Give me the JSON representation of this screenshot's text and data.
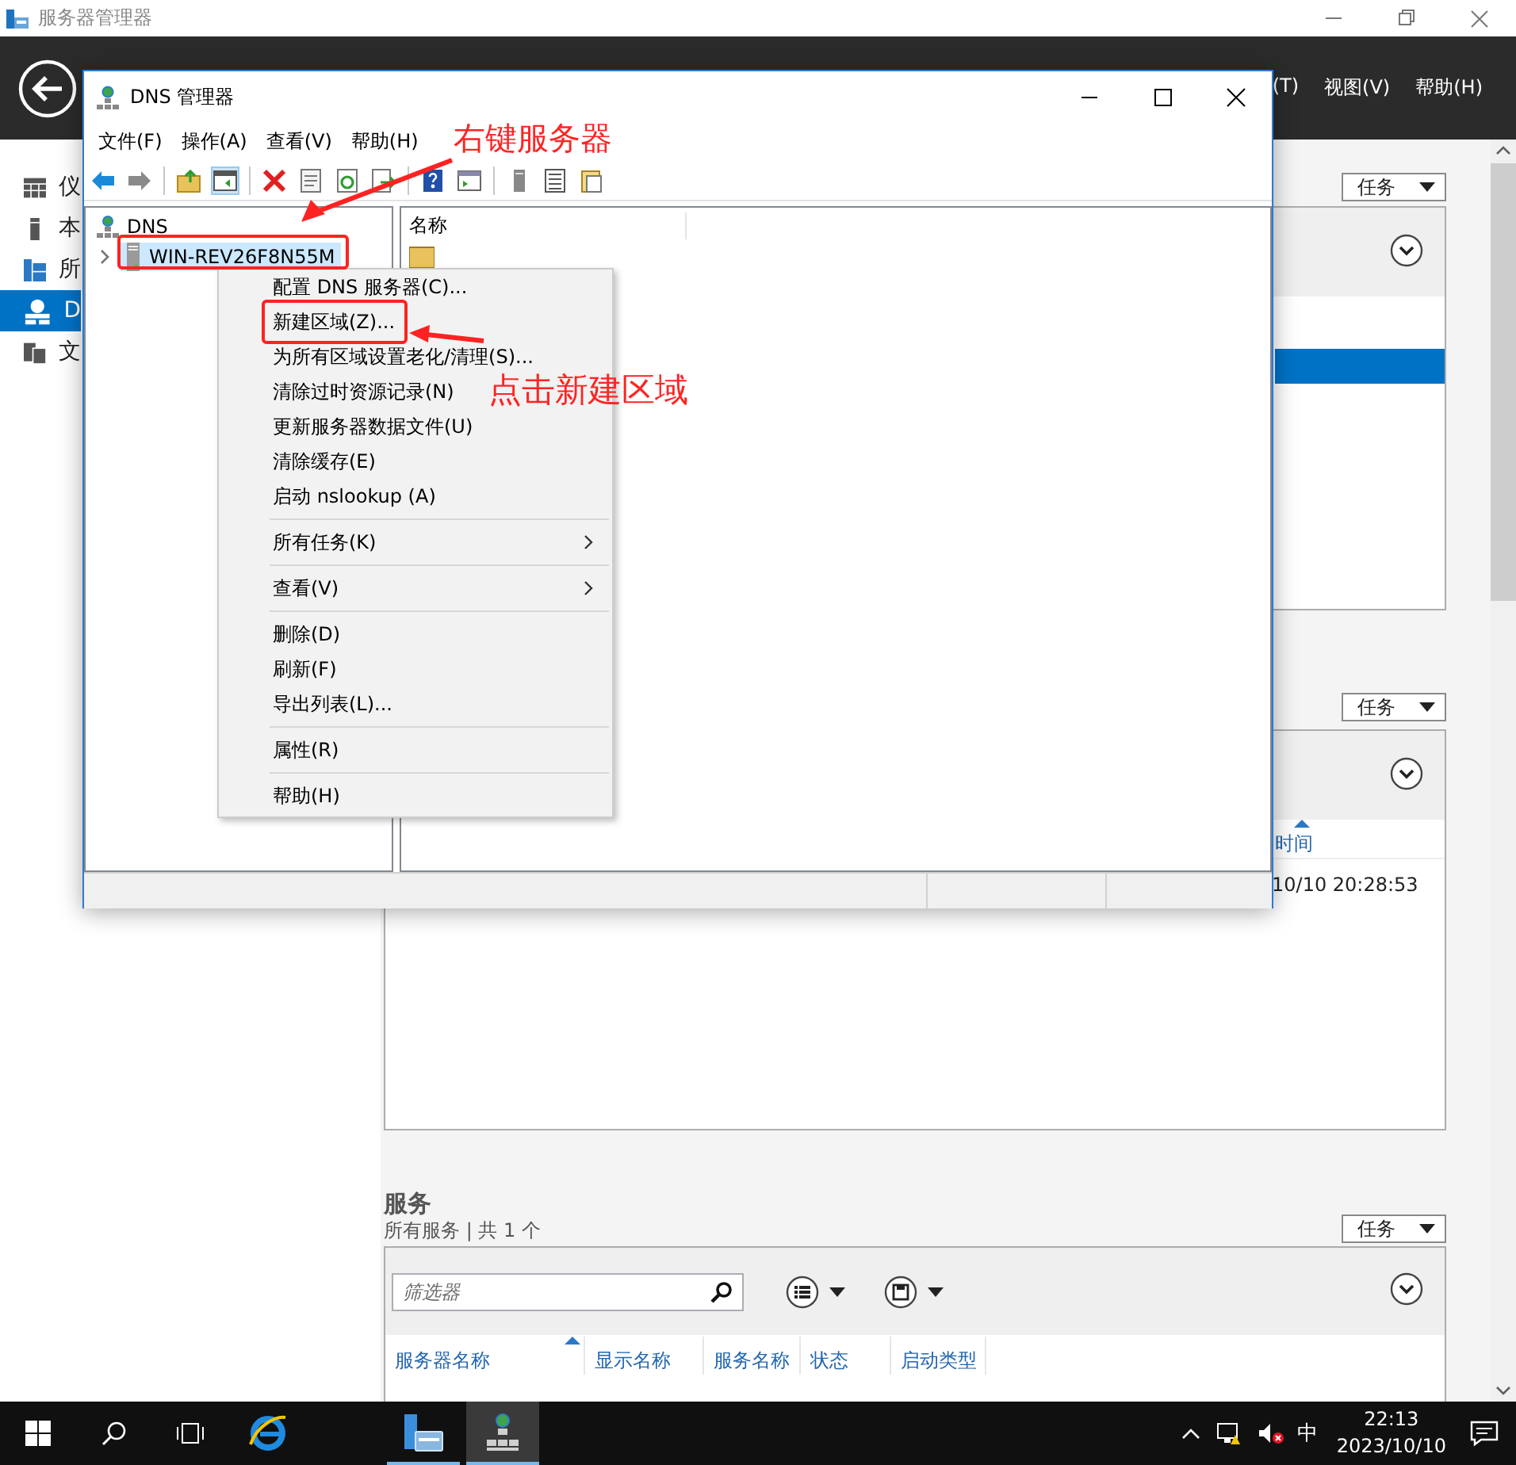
{
  "window": {
    "title": "服务器管理器"
  },
  "header": {
    "menu": [
      {
        "label": "(T)"
      },
      {
        "label": "视图(V)"
      },
      {
        "label": "帮助(H)"
      }
    ]
  },
  "nav": {
    "items": [
      {
        "kind": "dashboard",
        "label": "仪",
        "selected": false
      },
      {
        "kind": "local",
        "label": "本",
        "selected": false
      },
      {
        "kind": "all",
        "label": "所",
        "selected": false
      },
      {
        "kind": "dns",
        "label": "D",
        "selected": true
      },
      {
        "kind": "files",
        "label": "文",
        "selected": false
      }
    ]
  },
  "panel_1": {
    "tasks": "任务",
    "rows": [
      {
        "selected": true
      }
    ]
  },
  "panel_2": {
    "tasks": "任务",
    "columns": [
      {
        "label": "时间",
        "sorted": true
      }
    ],
    "rows": [
      [
        "10/10 20:28:53"
      ]
    ]
  },
  "services": {
    "title": "服务",
    "subtitle": "所有服务 | 共 1 个",
    "tasks": "任务",
    "filter": {
      "placeholder": "筛选器"
    },
    "columns": [
      {
        "label": "服务器名称",
        "sorted": true
      },
      {
        "label": "显示名称",
        "sorted": false
      },
      {
        "label": "服务名称",
        "sorted": false
      },
      {
        "label": "状态",
        "sorted": false
      },
      {
        "label": "启动类型",
        "sorted": false
      }
    ]
  },
  "dns_window": {
    "title": "DNS 管理器",
    "menu": [
      "文件(F)",
      "操作(A)",
      "查看(V)",
      "帮助(H)"
    ],
    "tree": {
      "label": "DNS",
      "children": [
        {
          "label": "WIN-REV26F8N55M",
          "expanded": false,
          "selected": true
        }
      ]
    },
    "list": {
      "columns": [
        "名称"
      ]
    }
  },
  "context_menu": {
    "items": [
      {
        "kind": "item",
        "label": "配置 DNS 服务器(C)..."
      },
      {
        "kind": "item",
        "label": "新建区域(Z)..."
      },
      {
        "kind": "item",
        "label": "为所有区域设置老化/清理(S)..."
      },
      {
        "kind": "item",
        "label": "清除过时资源记录(N)"
      },
      {
        "kind": "item",
        "label": "更新服务器数据文件(U)"
      },
      {
        "kind": "item",
        "label": "清除缓存(E)"
      },
      {
        "kind": "item",
        "label": "启动 nslookup (A)"
      },
      {
        "kind": "separator"
      },
      {
        "kind": "submenu",
        "label": "所有任务(K)"
      },
      {
        "kind": "separator"
      },
      {
        "kind": "submenu",
        "label": "查看(V)"
      },
      {
        "kind": "separator"
      },
      {
        "kind": "item",
        "label": "删除(D)"
      },
      {
        "kind": "item",
        "label": "刷新(F)"
      },
      {
        "kind": "item",
        "label": "导出列表(L)..."
      },
      {
        "kind": "separator"
      },
      {
        "kind": "item",
        "label": "属性(R)"
      },
      {
        "kind": "separator"
      },
      {
        "kind": "item",
        "label": "帮助(H)"
      }
    ]
  },
  "annotations": [
    {
      "text": "右键服务器"
    },
    {
      "text": "点击新建区域"
    }
  ],
  "taskbar": {
    "apps": [
      {
        "kind": "ie",
        "running": false,
        "selected": false
      },
      {
        "kind": "server-manager",
        "running": true,
        "selected": false
      },
      {
        "kind": "dns",
        "running": true,
        "selected": true
      }
    ],
    "ime": "中",
    "time": "22:13",
    "date": "2023/10/10"
  }
}
